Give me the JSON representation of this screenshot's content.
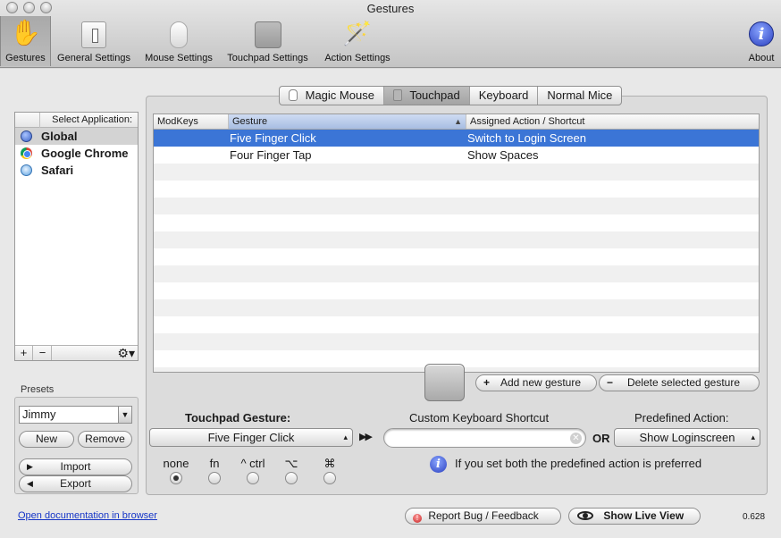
{
  "window": {
    "title": "Gestures"
  },
  "toolbar": {
    "items": [
      {
        "label": "Gestures",
        "icon": "hand-icon"
      },
      {
        "label": "General Settings",
        "icon": "switch-icon"
      },
      {
        "label": "Mouse Settings",
        "icon": "mouse-icon"
      },
      {
        "label": "Touchpad Settings",
        "icon": "touchpad-icon"
      },
      {
        "label": "Action Settings",
        "icon": "magic-wand-icon"
      },
      {
        "label": "About",
        "icon": "info-icon"
      }
    ],
    "selected": "Gestures"
  },
  "applications": {
    "header": "Select Application:",
    "items": [
      {
        "name": "Global",
        "icon": "globe-icon",
        "selected": true
      },
      {
        "name": "Google Chrome",
        "icon": "chrome-icon",
        "selected": false
      },
      {
        "name": "Safari",
        "icon": "safari-icon",
        "selected": false
      }
    ],
    "add_label": "+",
    "remove_label": "−",
    "gear_label": "⚙▾"
  },
  "presets": {
    "label": "Presets",
    "selected": "Jimmy",
    "new_label": "New",
    "remove_label": "Remove",
    "import_label": "Import",
    "export_label": "Export"
  },
  "device_tabs": {
    "items": [
      "Magic Mouse",
      "Touchpad",
      "Keyboard",
      "Normal Mice"
    ],
    "selected": "Touchpad"
  },
  "table": {
    "columns": [
      "ModKeys",
      "Gesture",
      "Assigned Action / Shortcut"
    ],
    "rows": [
      {
        "modkeys": "",
        "gesture": "Five Finger Click",
        "action": "Switch to Login Screen",
        "selected": true
      },
      {
        "modkeys": "",
        "gesture": "Four Finger Tap",
        "action": "Show Spaces",
        "selected": false
      }
    ]
  },
  "gesture_buttons": {
    "add_label": "Add new gesture",
    "delete_label": "Delete selected gesture"
  },
  "editor": {
    "gesture_label": "Touchpad Gesture:",
    "gesture_value": "Five Finger Click",
    "shortcut_label": "Custom Keyboard Shortcut",
    "shortcut_value": "",
    "or_label": "OR",
    "action_label": "Predefined Action:",
    "action_value": "Show Loginscreen",
    "modifiers": [
      "none",
      "fn",
      "^ ctrl",
      "⌥",
      "⌘"
    ],
    "modifier_selected": "none",
    "info_text": "If you set both the predefined action is preferred"
  },
  "footer": {
    "doc_link": "Open documentation in browser",
    "report_label": "Report Bug / Feedback",
    "live_view_label": "Show Live View",
    "version": "0.628"
  }
}
